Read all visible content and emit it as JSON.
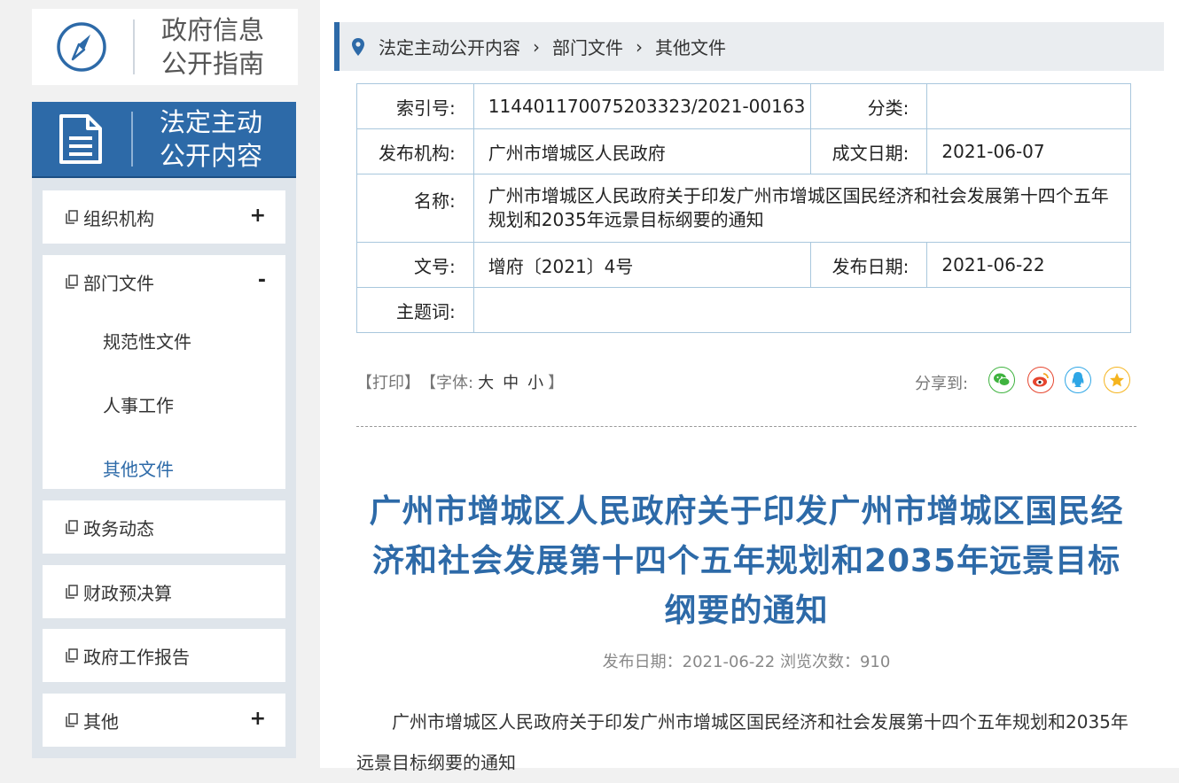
{
  "sidebar": {
    "guide_title": "政府信息公开指南",
    "legal_title": "法定主动公开内容",
    "nav": [
      {
        "label": "组织机构",
        "toggle": "+"
      },
      {
        "label": "部门文件",
        "toggle": "-",
        "children": [
          "规范性文件",
          "人事工作",
          "其他文件"
        ],
        "active_child": "其他文件"
      },
      {
        "label": "政务动态"
      },
      {
        "label": "财政预决算"
      },
      {
        "label": "政府工作报告"
      },
      {
        "label": "其他",
        "toggle": "+"
      }
    ]
  },
  "breadcrumb": [
    "法定主动公开内容",
    "部门文件",
    "其他文件"
  ],
  "info": {
    "index_label": "索引号:",
    "index_value": "114401170075203323/2021-00163",
    "category_label": "分类:",
    "category_value": "",
    "publisher_label": "发布机构:",
    "publisher_value": "广州市增城区人民政府",
    "written_date_label": "成文日期:",
    "written_date_value": "2021-06-07",
    "name_label": "名称:",
    "name_value": "广州市增城区人民政府关于印发广州市增城区国民经济和社会发展第十四个五年规划和2035年远景目标纲要的通知",
    "doc_no_label": "文号:",
    "doc_no_value": "增府〔2021〕4号",
    "publish_date_label": "发布日期:",
    "publish_date_value": "2021-06-22",
    "keywords_label": "主题词:",
    "keywords_value": ""
  },
  "tools": {
    "print": "【打印】",
    "font_prefix": "【字体:",
    "font_large": "大",
    "font_medium": "中",
    "font_small": "小",
    "font_suffix": "】",
    "share_label": "分享到:"
  },
  "share_icons": [
    {
      "name": "wechat-icon",
      "color": "#3fb33f"
    },
    {
      "name": "weibo-icon",
      "color": "#e6452e"
    },
    {
      "name": "qq-icon",
      "color": "#2ea6e6"
    },
    {
      "name": "qzone-icon",
      "color": "#f5b41e"
    }
  ],
  "article": {
    "title": "广州市增城区人民政府关于印发广州市增城区国民经济和社会发展第十四个五年规划和2035年远景目标纲要的通知",
    "meta": "发布日期：2021-06-22  浏览次数：910",
    "body": "广州市增城区人民政府关于印发广州市增城区国民经济和社会发展第十四个五年规划和2035年远景目标纲要的通知"
  },
  "colors": {
    "brand": "#2d6aa8",
    "nav_bg": "#dfe5eb"
  }
}
